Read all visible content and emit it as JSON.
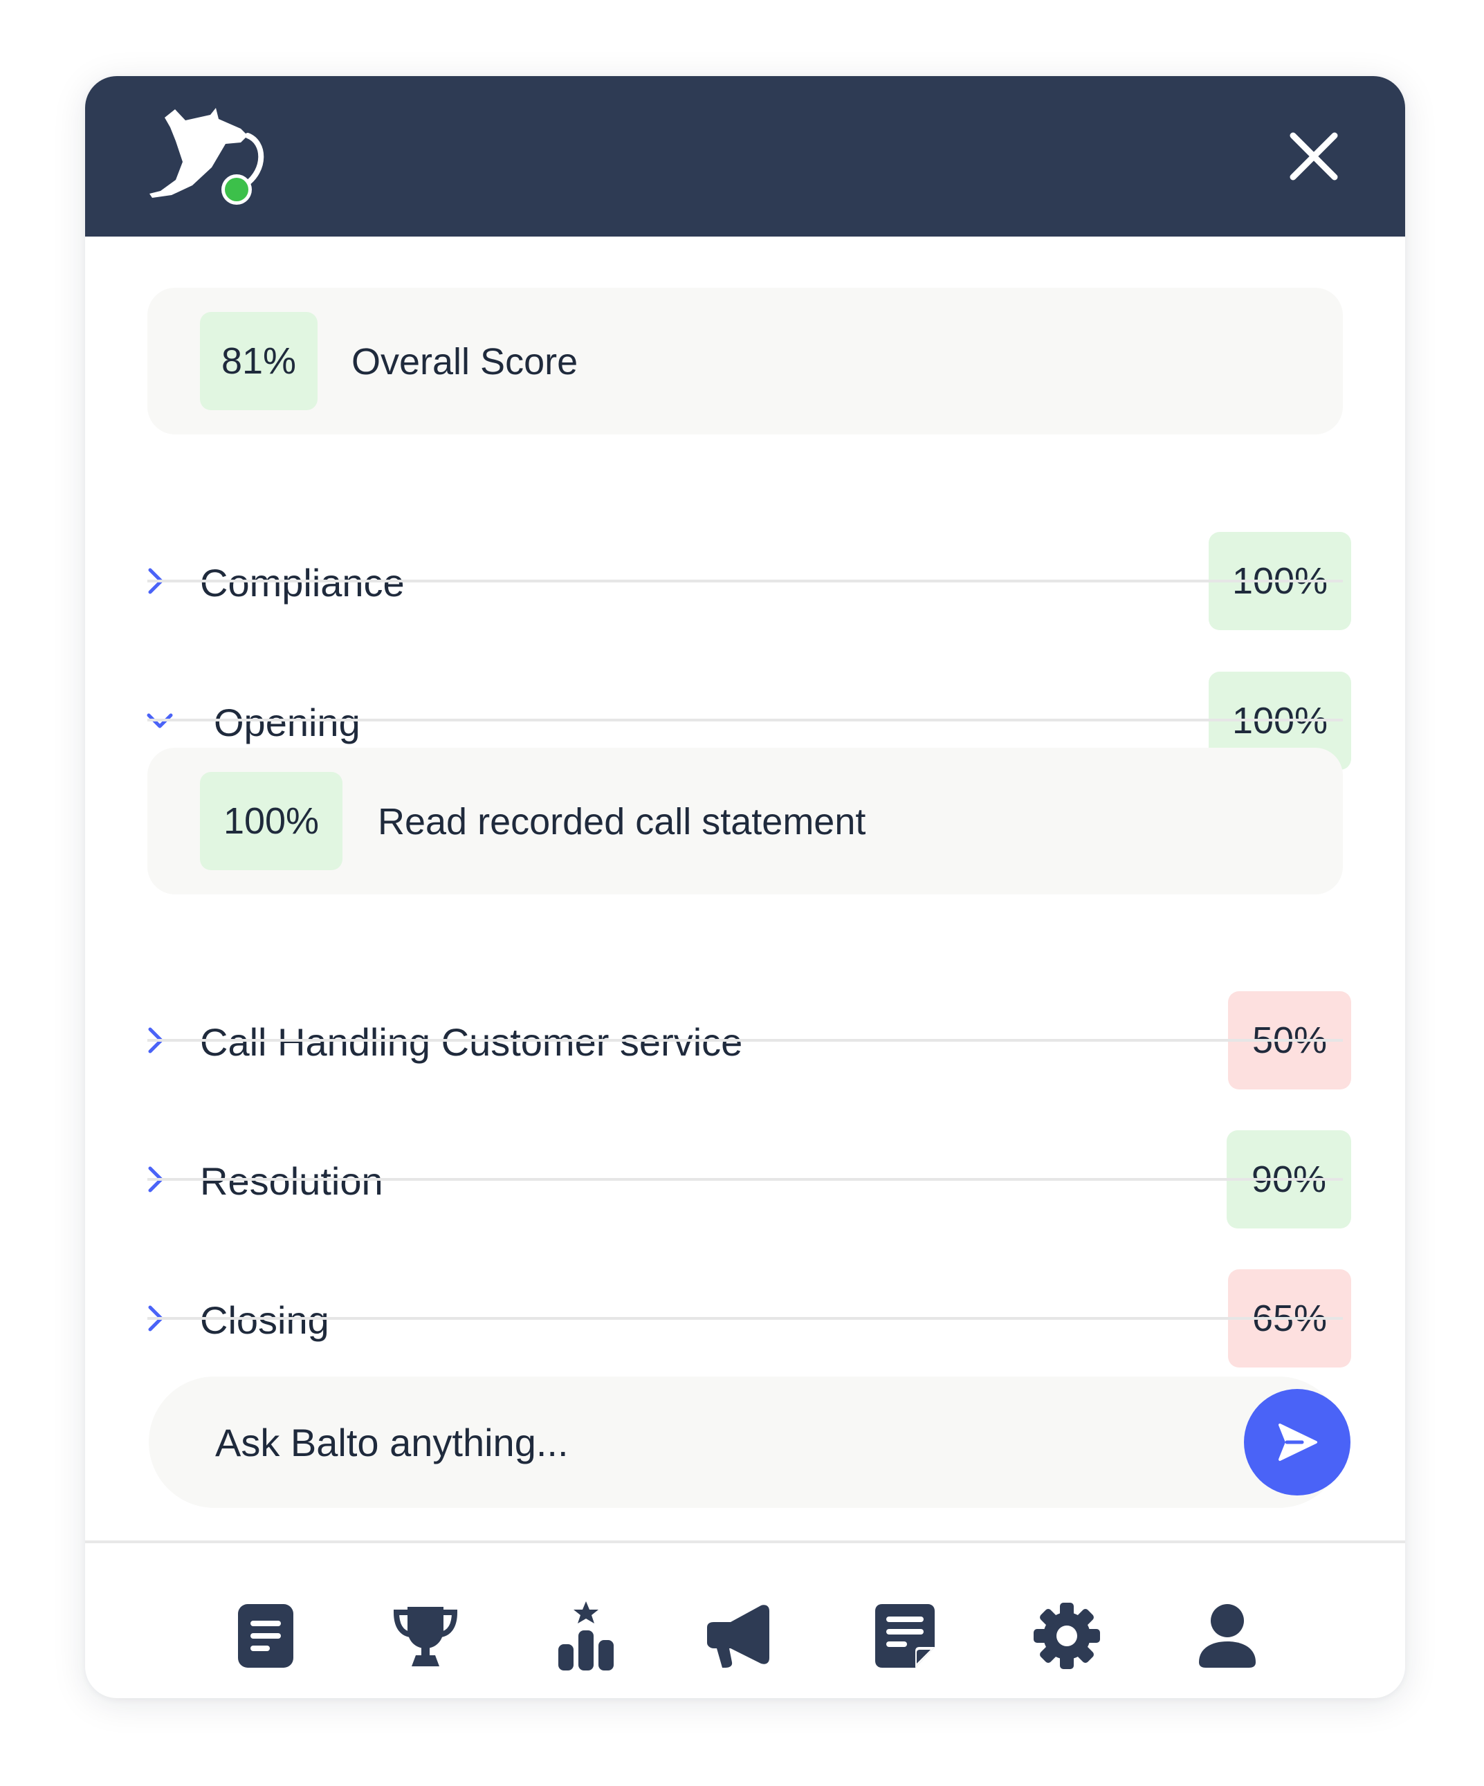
{
  "header": {
    "logo_name": "balto-dog-logo",
    "status_color": "#3cc04a",
    "close_icon": "close-icon"
  },
  "overall": {
    "value": "81%",
    "label": "Overall Score"
  },
  "sections": [
    {
      "label": "Compliance",
      "value": "100%",
      "status": "pass",
      "expanded": false
    },
    {
      "label": "Opening",
      "value": "100%",
      "status": "pass",
      "expanded": true
    },
    {
      "label": "Call Handling Customer service",
      "value": "50%",
      "status": "fail",
      "expanded": false
    },
    {
      "label": "Resolution",
      "value": "90%",
      "status": "pass",
      "expanded": false
    },
    {
      "label": "Closing",
      "value": "65%",
      "status": "fail",
      "expanded": false
    }
  ],
  "opening_detail": {
    "value": "100%",
    "label": "Read recorded call statement"
  },
  "ask": {
    "placeholder": "Ask Balto anything...",
    "send_icon": "send-icon"
  },
  "nav": [
    {
      "icon": "document-icon"
    },
    {
      "icon": "trophy-icon"
    },
    {
      "icon": "leaderboard-icon"
    },
    {
      "icon": "megaphone-icon"
    },
    {
      "icon": "notes-icon"
    },
    {
      "icon": "gear-icon"
    },
    {
      "icon": "user-icon"
    }
  ],
  "colors": {
    "header_bg": "#2e3b54",
    "accent": "#4a63f7",
    "pass_bg": "#e1f6e1",
    "fail_bg": "#fde0df",
    "text": "#1f2a3c"
  }
}
